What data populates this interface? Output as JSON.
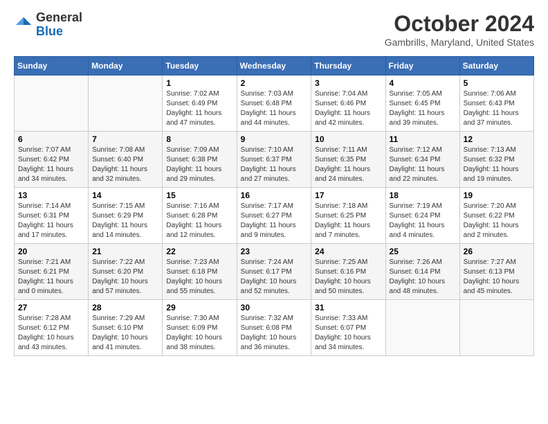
{
  "logo": {
    "general": "General",
    "blue": "Blue"
  },
  "title": "October 2024",
  "location": "Gambrills, Maryland, United States",
  "days_of_week": [
    "Sunday",
    "Monday",
    "Tuesday",
    "Wednesday",
    "Thursday",
    "Friday",
    "Saturday"
  ],
  "weeks": [
    [
      {
        "num": "",
        "sunrise": "",
        "sunset": "",
        "daylight": ""
      },
      {
        "num": "",
        "sunrise": "",
        "sunset": "",
        "daylight": ""
      },
      {
        "num": "1",
        "sunrise": "Sunrise: 7:02 AM",
        "sunset": "Sunset: 6:49 PM",
        "daylight": "Daylight: 11 hours and 47 minutes."
      },
      {
        "num": "2",
        "sunrise": "Sunrise: 7:03 AM",
        "sunset": "Sunset: 6:48 PM",
        "daylight": "Daylight: 11 hours and 44 minutes."
      },
      {
        "num": "3",
        "sunrise": "Sunrise: 7:04 AM",
        "sunset": "Sunset: 6:46 PM",
        "daylight": "Daylight: 11 hours and 42 minutes."
      },
      {
        "num": "4",
        "sunrise": "Sunrise: 7:05 AM",
        "sunset": "Sunset: 6:45 PM",
        "daylight": "Daylight: 11 hours and 39 minutes."
      },
      {
        "num": "5",
        "sunrise": "Sunrise: 7:06 AM",
        "sunset": "Sunset: 6:43 PM",
        "daylight": "Daylight: 11 hours and 37 minutes."
      }
    ],
    [
      {
        "num": "6",
        "sunrise": "Sunrise: 7:07 AM",
        "sunset": "Sunset: 6:42 PM",
        "daylight": "Daylight: 11 hours and 34 minutes."
      },
      {
        "num": "7",
        "sunrise": "Sunrise: 7:08 AM",
        "sunset": "Sunset: 6:40 PM",
        "daylight": "Daylight: 11 hours and 32 minutes."
      },
      {
        "num": "8",
        "sunrise": "Sunrise: 7:09 AM",
        "sunset": "Sunset: 6:38 PM",
        "daylight": "Daylight: 11 hours and 29 minutes."
      },
      {
        "num": "9",
        "sunrise": "Sunrise: 7:10 AM",
        "sunset": "Sunset: 6:37 PM",
        "daylight": "Daylight: 11 hours and 27 minutes."
      },
      {
        "num": "10",
        "sunrise": "Sunrise: 7:11 AM",
        "sunset": "Sunset: 6:35 PM",
        "daylight": "Daylight: 11 hours and 24 minutes."
      },
      {
        "num": "11",
        "sunrise": "Sunrise: 7:12 AM",
        "sunset": "Sunset: 6:34 PM",
        "daylight": "Daylight: 11 hours and 22 minutes."
      },
      {
        "num": "12",
        "sunrise": "Sunrise: 7:13 AM",
        "sunset": "Sunset: 6:32 PM",
        "daylight": "Daylight: 11 hours and 19 minutes."
      }
    ],
    [
      {
        "num": "13",
        "sunrise": "Sunrise: 7:14 AM",
        "sunset": "Sunset: 6:31 PM",
        "daylight": "Daylight: 11 hours and 17 minutes."
      },
      {
        "num": "14",
        "sunrise": "Sunrise: 7:15 AM",
        "sunset": "Sunset: 6:29 PM",
        "daylight": "Daylight: 11 hours and 14 minutes."
      },
      {
        "num": "15",
        "sunrise": "Sunrise: 7:16 AM",
        "sunset": "Sunset: 6:28 PM",
        "daylight": "Daylight: 11 hours and 12 minutes."
      },
      {
        "num": "16",
        "sunrise": "Sunrise: 7:17 AM",
        "sunset": "Sunset: 6:27 PM",
        "daylight": "Daylight: 11 hours and 9 minutes."
      },
      {
        "num": "17",
        "sunrise": "Sunrise: 7:18 AM",
        "sunset": "Sunset: 6:25 PM",
        "daylight": "Daylight: 11 hours and 7 minutes."
      },
      {
        "num": "18",
        "sunrise": "Sunrise: 7:19 AM",
        "sunset": "Sunset: 6:24 PM",
        "daylight": "Daylight: 11 hours and 4 minutes."
      },
      {
        "num": "19",
        "sunrise": "Sunrise: 7:20 AM",
        "sunset": "Sunset: 6:22 PM",
        "daylight": "Daylight: 11 hours and 2 minutes."
      }
    ],
    [
      {
        "num": "20",
        "sunrise": "Sunrise: 7:21 AM",
        "sunset": "Sunset: 6:21 PM",
        "daylight": "Daylight: 11 hours and 0 minutes."
      },
      {
        "num": "21",
        "sunrise": "Sunrise: 7:22 AM",
        "sunset": "Sunset: 6:20 PM",
        "daylight": "Daylight: 10 hours and 57 minutes."
      },
      {
        "num": "22",
        "sunrise": "Sunrise: 7:23 AM",
        "sunset": "Sunset: 6:18 PM",
        "daylight": "Daylight: 10 hours and 55 minutes."
      },
      {
        "num": "23",
        "sunrise": "Sunrise: 7:24 AM",
        "sunset": "Sunset: 6:17 PM",
        "daylight": "Daylight: 10 hours and 52 minutes."
      },
      {
        "num": "24",
        "sunrise": "Sunrise: 7:25 AM",
        "sunset": "Sunset: 6:16 PM",
        "daylight": "Daylight: 10 hours and 50 minutes."
      },
      {
        "num": "25",
        "sunrise": "Sunrise: 7:26 AM",
        "sunset": "Sunset: 6:14 PM",
        "daylight": "Daylight: 10 hours and 48 minutes."
      },
      {
        "num": "26",
        "sunrise": "Sunrise: 7:27 AM",
        "sunset": "Sunset: 6:13 PM",
        "daylight": "Daylight: 10 hours and 45 minutes."
      }
    ],
    [
      {
        "num": "27",
        "sunrise": "Sunrise: 7:28 AM",
        "sunset": "Sunset: 6:12 PM",
        "daylight": "Daylight: 10 hours and 43 minutes."
      },
      {
        "num": "28",
        "sunrise": "Sunrise: 7:29 AM",
        "sunset": "Sunset: 6:10 PM",
        "daylight": "Daylight: 10 hours and 41 minutes."
      },
      {
        "num": "29",
        "sunrise": "Sunrise: 7:30 AM",
        "sunset": "Sunset: 6:09 PM",
        "daylight": "Daylight: 10 hours and 38 minutes."
      },
      {
        "num": "30",
        "sunrise": "Sunrise: 7:32 AM",
        "sunset": "Sunset: 6:08 PM",
        "daylight": "Daylight: 10 hours and 36 minutes."
      },
      {
        "num": "31",
        "sunrise": "Sunrise: 7:33 AM",
        "sunset": "Sunset: 6:07 PM",
        "daylight": "Daylight: 10 hours and 34 minutes."
      },
      {
        "num": "",
        "sunrise": "",
        "sunset": "",
        "daylight": ""
      },
      {
        "num": "",
        "sunrise": "",
        "sunset": "",
        "daylight": ""
      }
    ]
  ]
}
